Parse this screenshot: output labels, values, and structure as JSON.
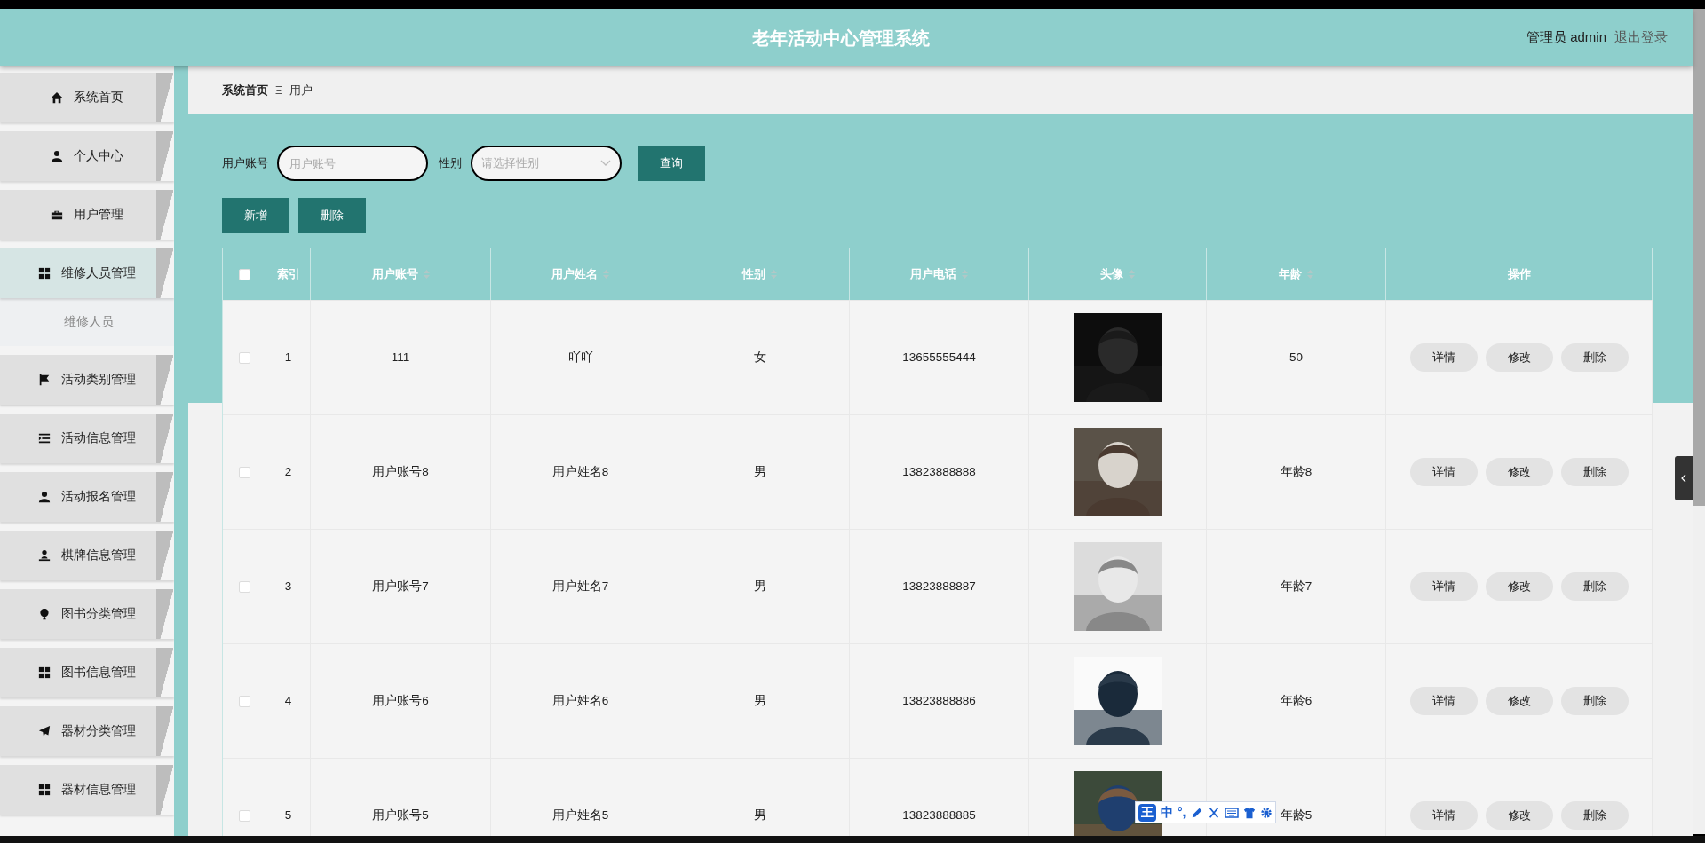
{
  "header": {
    "title": "老年活动中心管理系统",
    "user_label": "管理员 admin",
    "logout": "退出登录"
  },
  "sidebar": {
    "items": [
      {
        "label": "系统首页",
        "expanded": false
      },
      {
        "label": "个人中心",
        "expanded": false
      },
      {
        "label": "用户管理",
        "expanded": false
      },
      {
        "label": "维修人员管理",
        "expanded": true,
        "children": [
          {
            "label": "维修人员"
          }
        ]
      },
      {
        "label": "活动类别管理",
        "expanded": false
      },
      {
        "label": "活动信息管理",
        "expanded": false
      },
      {
        "label": "活动报名管理",
        "expanded": false
      },
      {
        "label": "棋牌信息管理",
        "expanded": false
      },
      {
        "label": "图书分类管理",
        "expanded": false
      },
      {
        "label": "图书信息管理",
        "expanded": false
      },
      {
        "label": "器材分类管理",
        "expanded": false
      },
      {
        "label": "器材信息管理",
        "expanded": false
      }
    ]
  },
  "breadcrumb": {
    "items": [
      "系统首页",
      "用户"
    ],
    "separator": "Ξ"
  },
  "search": {
    "fields": [
      {
        "label": "用户账号",
        "placeholder": "用户账号",
        "kind": "text"
      },
      {
        "label": "性别",
        "placeholder": "请选择性别",
        "kind": "select"
      }
    ],
    "button": "查询"
  },
  "actions": [
    "新增",
    "删除"
  ],
  "table": {
    "select_all_checked": false,
    "columns": [
      {
        "label": "索引",
        "sortable": false
      },
      {
        "label": "用户账号",
        "sortable": true
      },
      {
        "label": "用户姓名",
        "sortable": true
      },
      {
        "label": "性别",
        "sortable": true
      },
      {
        "label": "用户电话",
        "sortable": true
      },
      {
        "label": "头像",
        "sortable": true
      },
      {
        "label": "年龄",
        "sortable": true
      },
      {
        "label": "操作",
        "sortable": false
      }
    ],
    "rows": [
      {
        "checked": false,
        "cells": [
          "1",
          "111",
          "吖吖",
          "女",
          "13655555444",
          "50"
        ],
        "actions": [
          "详情",
          "修改",
          "删除"
        ]
      },
      {
        "checked": false,
        "cells": [
          "2",
          "用户账号8",
          "用户姓名8",
          "男",
          "13823888888",
          "年龄8"
        ],
        "actions": [
          "详情",
          "修改",
          "删除"
        ]
      },
      {
        "checked": false,
        "cells": [
          "3",
          "用户账号7",
          "用户姓名7",
          "男",
          "13823888887",
          "年龄7"
        ],
        "actions": [
          "详情",
          "修改",
          "删除"
        ]
      },
      {
        "checked": false,
        "cells": [
          "4",
          "用户账号6",
          "用户姓名6",
          "男",
          "13823888886",
          "年龄6"
        ],
        "actions": [
          "详情",
          "修改",
          "删除"
        ]
      },
      {
        "checked": false,
        "cells": [
          "5",
          "用户账号5",
          "用户姓名5",
          "男",
          "13823888885",
          "年龄5"
        ],
        "actions": [
          "详情",
          "修改",
          "删除"
        ]
      }
    ]
  },
  "ime_toolbar": {
    "items": [
      "王",
      "中",
      "°,"
    ]
  }
}
